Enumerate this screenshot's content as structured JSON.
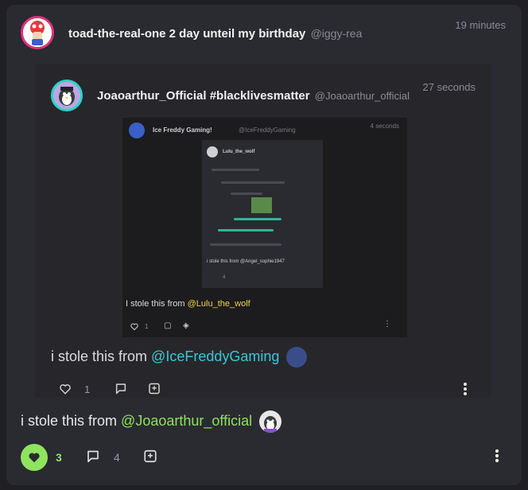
{
  "post": {
    "username": "toad-the-real-one 2 day unteil my birthday",
    "handle": "@iggy-rea",
    "time": "19 minutes",
    "caption_prefix": "i stole this from ",
    "caption_mention": "@Joaoarthur_official",
    "likes": "3",
    "comments": "4"
  },
  "embed": {
    "username": "Joaoarthur_Official #blacklivesmatter",
    "handle": "@Joaoarthur_official",
    "time": "27 seconds",
    "caption_prefix": "i stole this from ",
    "caption_mention": "@IceFreddyGaming",
    "likes": "1",
    "image": {
      "username": "Ice Freddy Gaming!",
      "handle": "@IceFreddyGaming",
      "time": "4 seconds",
      "caption_prefix": "I stole this from ",
      "caption_mention": "@Lulu_the_wolf",
      "likes": "1",
      "inner": {
        "username": "Lulu_the_wolf",
        "caption": "i stole this from @Angel_sophie1947",
        "likes": "4"
      }
    }
  },
  "colors": {
    "accent_green": "#8fe45e",
    "accent_cyan": "#38c8d8",
    "avatar_ring": "#e2317a"
  }
}
